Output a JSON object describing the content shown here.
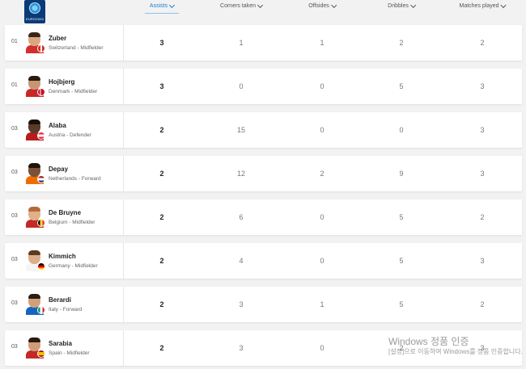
{
  "logo": {
    "text": "EURO2020"
  },
  "columns": [
    {
      "label": "Assists",
      "active": true
    },
    {
      "label": "Corners taken",
      "active": false
    },
    {
      "label": "Offsides",
      "active": false
    },
    {
      "label": "Dribbles",
      "active": false
    },
    {
      "label": "Matches played",
      "active": false
    }
  ],
  "players": [
    {
      "rank": "01",
      "name": "Zuber",
      "meta": "Switzerland - Midfielder",
      "assists": "3",
      "corners": "1",
      "offsides": "1",
      "dribbles": "2",
      "matches": "2",
      "skin": "#d9a77f",
      "hair": "#3a2618",
      "shirt": "#d32f2f",
      "flag": "switzerland"
    },
    {
      "rank": "01",
      "name": "Hojbjerg",
      "meta": "Denmark - Midfielder",
      "assists": "3",
      "corners": "0",
      "offsides": "0",
      "dribbles": "5",
      "matches": "3",
      "skin": "#c99571",
      "hair": "#2a1a10",
      "shirt": "#c62828",
      "flag": "denmark"
    },
    {
      "rank": "03",
      "name": "Alaba",
      "meta": "Austria - Defender",
      "assists": "2",
      "corners": "15",
      "offsides": "0",
      "dribbles": "0",
      "matches": "3",
      "skin": "#5a3a2a",
      "hair": "#1a1008",
      "shirt": "#b71c1c",
      "flag": "austria"
    },
    {
      "rank": "03",
      "name": "Depay",
      "meta": "Netherlands - Forward",
      "assists": "2",
      "corners": "12",
      "offsides": "2",
      "dribbles": "9",
      "matches": "3",
      "skin": "#7a5038",
      "hair": "#1e1209",
      "shirt": "#ef6c00",
      "flag": "netherlands"
    },
    {
      "rank": "03",
      "name": "De Bruyne",
      "meta": "Belgium - Midfielder",
      "assists": "2",
      "corners": "6",
      "offsides": "0",
      "dribbles": "5",
      "matches": "2",
      "skin": "#e0b08a",
      "hair": "#b56a3a",
      "shirt": "#c62828",
      "flag": "belgium"
    },
    {
      "rank": "03",
      "name": "Kimmich",
      "meta": "Germany - Midfielder",
      "assists": "2",
      "corners": "4",
      "offsides": "0",
      "dribbles": "5",
      "matches": "3",
      "skin": "#dcae8c",
      "hair": "#5a3a22",
      "shirt": "#f5f5f5",
      "flag": "germany"
    },
    {
      "rank": "03",
      "name": "Berardi",
      "meta": "Italy - Forward",
      "assists": "2",
      "corners": "3",
      "offsides": "1",
      "dribbles": "5",
      "matches": "2",
      "skin": "#d2a07a",
      "hair": "#2b1d12",
      "shirt": "#1565c0",
      "flag": "italy"
    },
    {
      "rank": "03",
      "name": "Sarabia",
      "meta": "Spain - Midfielder",
      "assists": "2",
      "corners": "3",
      "offsides": "0",
      "dribbles": "2",
      "matches": "3",
      "skin": "#cf9d78",
      "hair": "#2a1a10",
      "shirt": "#c62828",
      "flag": "spain"
    }
  ],
  "watermark": {
    "line1": "Windows 정품 인증",
    "line2": "[설정]으로 이동하여 Windows를 정품 인증합니다."
  }
}
